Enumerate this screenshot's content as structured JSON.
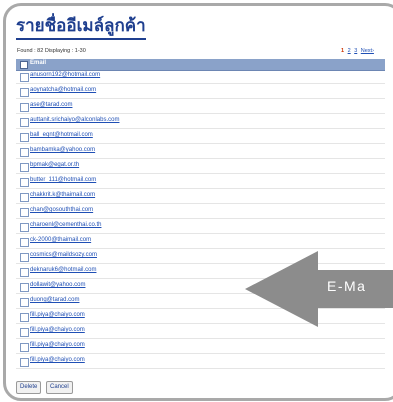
{
  "page": {
    "title": "รายชื่ออีเมล์ลูกค้า",
    "found_label": "Found : 82  Displaying : 1-30"
  },
  "pager": {
    "current": "1",
    "pages": [
      "2",
      "3"
    ],
    "next_label": "Next›"
  },
  "table": {
    "header_label": "Email",
    "rows": [
      "anusorn192@hotmail.com",
      "aoynatcha@hotmail.com",
      "ase@tarad.com",
      "auttanit.srichaiyo@alconlabs.com",
      "ball_eqnt@hotmail.com",
      "bambamka@yahoo.com",
      "bpmak@egat.or.th",
      "butter_111@hotmail.com",
      "chakkrit.k@thaimail.com",
      "chan@gosouththai.com",
      "charoenl@cementhai.co.th",
      "ck-2000@thaimail.com",
      "cosmics@maildsozy.com",
      "deknaruk6@hotmail.com",
      "dollawit@yahoo.com",
      "duong@tarad.com",
      "fill.piya@chaiyo.com",
      "fill.piya@chaiyo.com",
      "fill.piya@chaiyo.com",
      "fill.piya@chaiyo.com"
    ]
  },
  "actions": {
    "delete_label": "Delete",
    "cancel_label": "Cancel"
  },
  "annotation": {
    "label": "E-Ma"
  },
  "colors": {
    "title": "#1f3f8f",
    "header_bg": "#8aa2c9",
    "link": "#1f4fb5",
    "arrow": "#8c8c8c"
  }
}
